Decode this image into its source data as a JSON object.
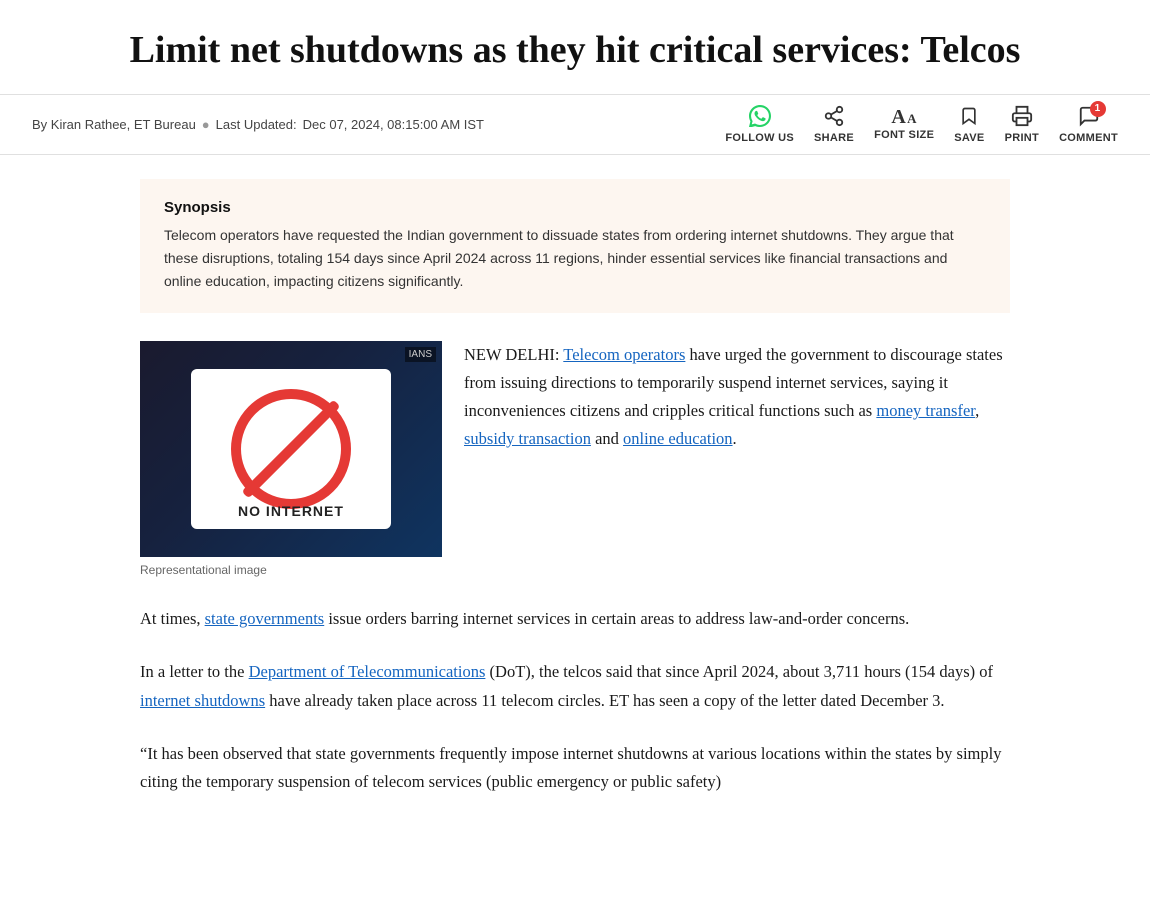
{
  "article": {
    "title": "Limit net shutdowns as they hit critical services: Telcos",
    "author": "By Kiran Rathee, ET Bureau",
    "separator": "●",
    "last_updated_label": "Last Updated:",
    "last_updated_date": "Dec 07, 2024, 08:15:00 AM IST",
    "synopsis_heading": "Synopsis",
    "synopsis_text": "Telecom operators have requested the Indian government to dissuade states from ordering internet shutdowns. They argue that these disruptions, totaling 154 days since April 2024 across 11 regions, hinder essential services like financial transactions and online education, impacting citizens significantly.",
    "image_caption": "Representational image",
    "image_label": "IANS",
    "paragraphs": [
      {
        "id": "p1",
        "before_link1": "NEW DELHI: ",
        "link1_text": "Telecom operators",
        "link1_href": "#",
        "after_link1": " have urged the government to discourage states from issuing directions to temporarily suspend internet services, saying it inconveniences citizens and cripples critical functions such as ",
        "link2_text": "money transfer",
        "link2_href": "#",
        "middle_text": ", ",
        "link3_text": "subsidy transaction",
        "link3_href": "#",
        "end_text": " and ",
        "link4_text": "online education",
        "link4_href": "#",
        "final_text": "."
      },
      {
        "id": "p2",
        "before_link": "At times, ",
        "link_text": "state governments",
        "link_href": "#",
        "after_link": " issue orders barring internet services in certain areas to address law-and-order concerns."
      },
      {
        "id": "p3",
        "before_link": "In a letter to the ",
        "link_text": "Department of Telecommunications",
        "link_href": "#",
        "middle": " (DoT), the telcos said that since April 2024, about 3,711 hours (154 days) of ",
        "link2_text": "internet shutdowns",
        "link2_href": "#",
        "after": " have already taken place across 11 telecom circles. ET has seen a copy of the letter dated December 3."
      },
      {
        "id": "p4",
        "text": "“It has been observed that state governments frequently impose internet shutdowns at various locations within the states by simply citing the temporary suspension of telecom services (public emergency or public safety)"
      }
    ]
  },
  "toolbar": {
    "follow_us_label": "FOLLOW US",
    "share_label": "SHARE",
    "font_size_label": "FONT SIZE",
    "save_label": "SAVE",
    "print_label": "PRINT",
    "comment_label": "COMMENT",
    "comment_badge": "1"
  }
}
